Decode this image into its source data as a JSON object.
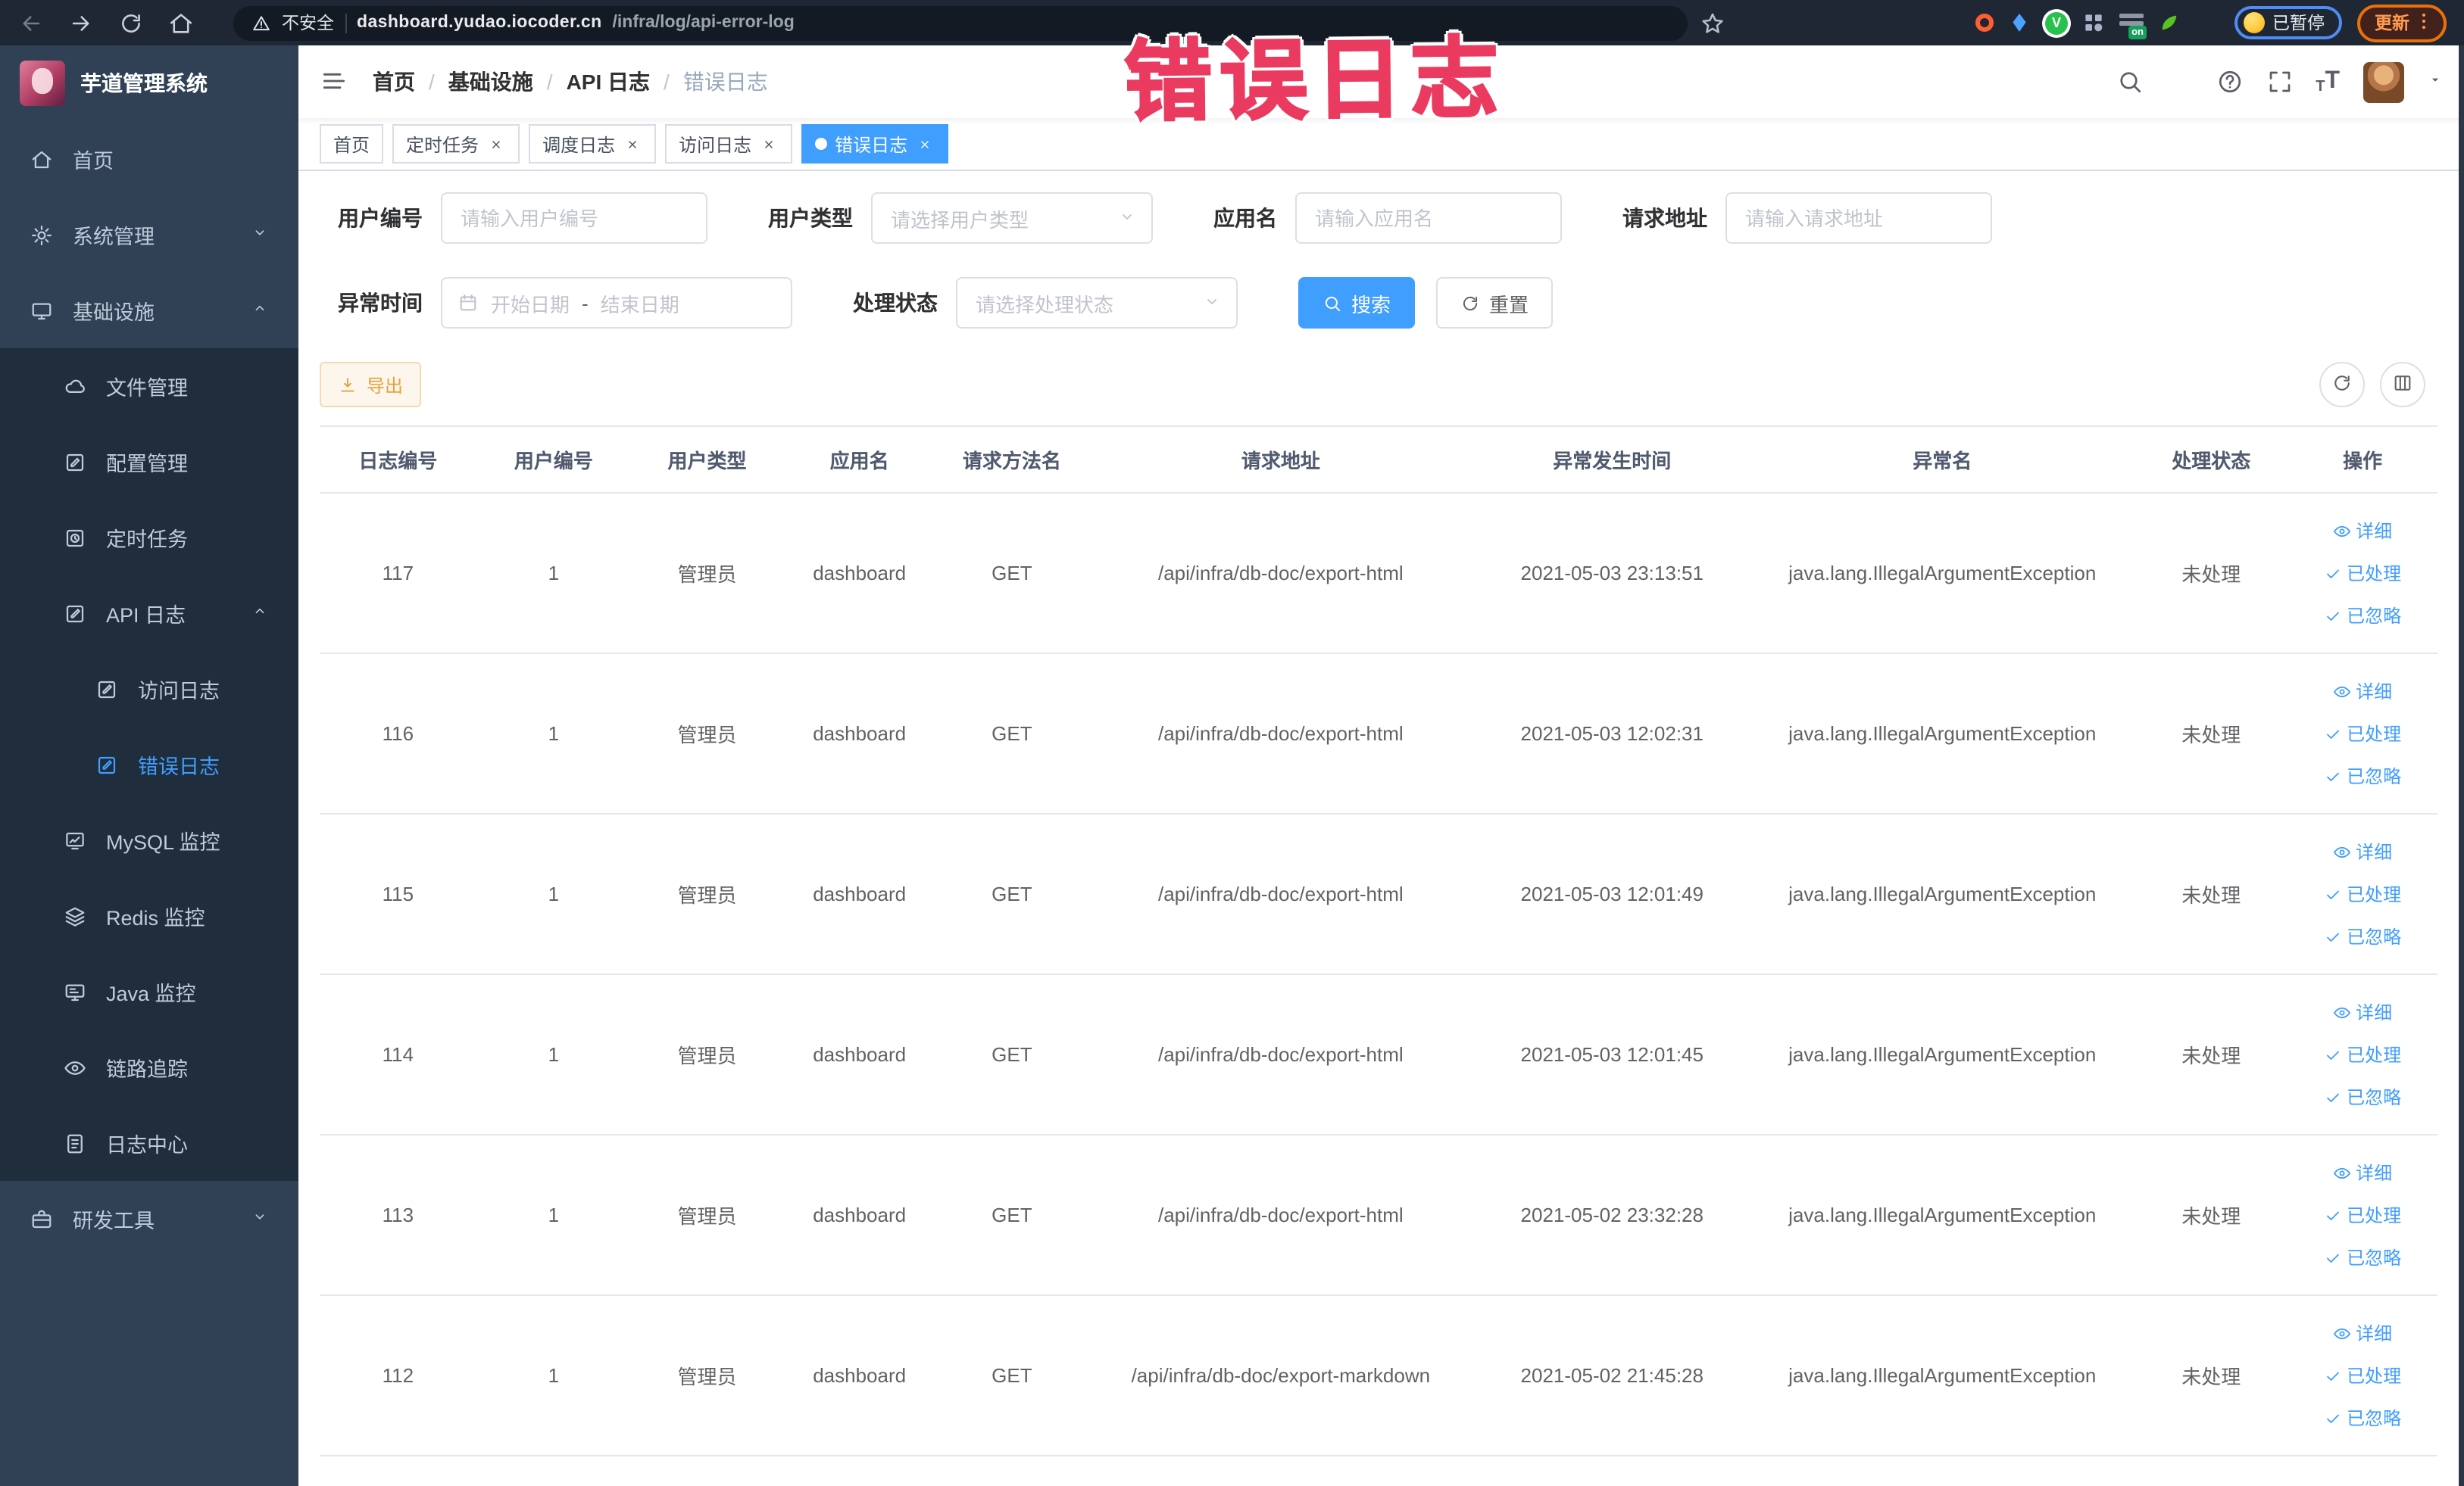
{
  "browser": {
    "security_label": "不安全",
    "url_domain": "dashboard.yudao.iocoder.cn",
    "url_path": "/infra/log/api-error-log",
    "paused_badge": "已暂停",
    "update_label": "更新",
    "extensions": [
      {
        "name": "extension-adblock-icon",
        "shape": "ring"
      },
      {
        "name": "extension-shield-icon",
        "shape": "drop"
      },
      {
        "name": "extension-v-icon",
        "shape": "circle-v",
        "letter": "V"
      },
      {
        "name": "extension-grid-icon",
        "shape": "grid4"
      },
      {
        "name": "extension-on-badge-icon",
        "shape": "on",
        "text": "on"
      },
      {
        "name": "extension-leaf-icon",
        "shape": "leaf"
      },
      {
        "name": "extension-puzzle-icon",
        "shape": "puzzle"
      }
    ]
  },
  "annotation": {
    "text": "错误日志",
    "color": "#ea3a5f"
  },
  "sidebar": {
    "title": "芋道管理系统",
    "items": [
      {
        "id": "home",
        "label": "首页",
        "icon": "home-icon",
        "glyph": "home",
        "depth": 0,
        "sub": false
      },
      {
        "id": "system",
        "label": "系统管理",
        "icon": "gear-icon",
        "glyph": "gear",
        "depth": 0,
        "sub": false,
        "arrow": "down"
      },
      {
        "id": "infra",
        "label": "基础设施",
        "icon": "monitor-icon",
        "glyph": "monitor",
        "depth": 0,
        "sub": false,
        "arrow": "up"
      },
      {
        "id": "file",
        "label": "文件管理",
        "icon": "cloud-icon",
        "glyph": "cloud",
        "depth": 1,
        "sub": true
      },
      {
        "id": "config",
        "label": "配置管理",
        "icon": "edit-icon",
        "glyph": "edit",
        "depth": 1,
        "sub": true
      },
      {
        "id": "job",
        "label": "定时任务",
        "icon": "timer-icon",
        "glyph": "timer",
        "depth": 1,
        "sub": true
      },
      {
        "id": "api-log",
        "label": "API 日志",
        "icon": "log-icon",
        "glyph": "log",
        "depth": 1,
        "sub": true,
        "arrow": "up"
      },
      {
        "id": "access-log",
        "label": "访问日志",
        "icon": "log-icon",
        "glyph": "log",
        "depth": 2,
        "sub": true
      },
      {
        "id": "error-log",
        "label": "错误日志",
        "icon": "log-icon",
        "glyph": "log",
        "depth": 2,
        "sub": true,
        "active": true
      },
      {
        "id": "mysql",
        "label": "MySQL 监控",
        "icon": "chart-icon",
        "glyph": "chart",
        "depth": 1,
        "sub": true
      },
      {
        "id": "redis",
        "label": "Redis 监控",
        "icon": "layers-icon",
        "glyph": "layers",
        "depth": 1,
        "sub": true
      },
      {
        "id": "java",
        "label": "Java 监控",
        "icon": "screen-icon",
        "glyph": "screen",
        "depth": 1,
        "sub": true
      },
      {
        "id": "tracer",
        "label": "链路追踪",
        "icon": "eye-icon",
        "glyph": "eye",
        "depth": 1,
        "sub": true
      },
      {
        "id": "log-center",
        "label": "日志中心",
        "icon": "doc-icon",
        "glyph": "doc",
        "depth": 1,
        "sub": true
      },
      {
        "id": "dev-tools",
        "label": "研发工具",
        "icon": "briefcase-icon",
        "glyph": "briefcase",
        "depth": 0,
        "sub": false,
        "arrow": "down"
      }
    ]
  },
  "header": {
    "breadcrumb": [
      "首页",
      "基础设施",
      "API 日志",
      "错误日志"
    ]
  },
  "tabs": [
    {
      "label": "首页",
      "closable": false,
      "active": false
    },
    {
      "label": "定时任务",
      "closable": true,
      "active": false
    },
    {
      "label": "调度日志",
      "closable": true,
      "active": false
    },
    {
      "label": "访问日志",
      "closable": true,
      "active": false
    },
    {
      "label": "错误日志",
      "closable": true,
      "active": true
    }
  ],
  "filters": {
    "user_id_label": "用户编号",
    "user_id_placeholder": "请输入用户编号",
    "user_type_label": "用户类型",
    "user_type_placeholder": "请选择用户类型",
    "app_name_label": "应用名",
    "app_name_placeholder": "请输入应用名",
    "request_url_label": "请求地址",
    "request_url_placeholder": "请输入请求地址",
    "exception_time_label": "异常时间",
    "start_date_placeholder": "开始日期",
    "date_separator": "-",
    "end_date_placeholder": "结束日期",
    "process_status_label": "处理状态",
    "process_status_placeholder": "请选择处理状态",
    "search_label": "搜索",
    "reset_label": "重置"
  },
  "toolbar": {
    "export_label": "导出"
  },
  "table": {
    "columns": [
      "日志编号",
      "用户编号",
      "用户类型",
      "应用名",
      "请求方法名",
      "请求地址",
      "异常发生时间",
      "异常名",
      "处理状态",
      "操作"
    ],
    "row_actions": [
      "详细",
      "已处理",
      "已忽略"
    ],
    "rows": [
      {
        "log_id": "117",
        "user_id": "1",
        "user_type": "管理员",
        "app_name": "dashboard",
        "method_name": "GET",
        "request_url": "/api/infra/db-doc/export-html",
        "exception_time": "2021-05-03 23:13:51",
        "exception_name": "java.lang.IllegalArgumentException",
        "process_status": "未处理"
      },
      {
        "log_id": "116",
        "user_id": "1",
        "user_type": "管理员",
        "app_name": "dashboard",
        "method_name": "GET",
        "request_url": "/api/infra/db-doc/export-html",
        "exception_time": "2021-05-03 12:02:31",
        "exception_name": "java.lang.IllegalArgumentException",
        "process_status": "未处理"
      },
      {
        "log_id": "115",
        "user_id": "1",
        "user_type": "管理员",
        "app_name": "dashboard",
        "method_name": "GET",
        "request_url": "/api/infra/db-doc/export-html",
        "exception_time": "2021-05-03 12:01:49",
        "exception_name": "java.lang.IllegalArgumentException",
        "process_status": "未处理"
      },
      {
        "log_id": "114",
        "user_id": "1",
        "user_type": "管理员",
        "app_name": "dashboard",
        "method_name": "GET",
        "request_url": "/api/infra/db-doc/export-html",
        "exception_time": "2021-05-03 12:01:45",
        "exception_name": "java.lang.IllegalArgumentException",
        "process_status": "未处理"
      },
      {
        "log_id": "113",
        "user_id": "1",
        "user_type": "管理员",
        "app_name": "dashboard",
        "method_name": "GET",
        "request_url": "/api/infra/db-doc/export-html",
        "exception_time": "2021-05-02 23:32:28",
        "exception_name": "java.lang.IllegalArgumentException",
        "process_status": "未处理"
      },
      {
        "log_id": "112",
        "user_id": "1",
        "user_type": "管理员",
        "app_name": "dashboard",
        "method_name": "GET",
        "request_url": "/api/infra/db-doc/export-markdown",
        "exception_time": "2021-05-02 21:45:28",
        "exception_name": "java.lang.IllegalArgumentException",
        "process_status": "未处理"
      }
    ]
  },
  "colors": {
    "primary": "#409eff",
    "warning": "#e6a23c",
    "sidebar_bg": "#304156",
    "submenu_bg": "#1f2d3d"
  }
}
